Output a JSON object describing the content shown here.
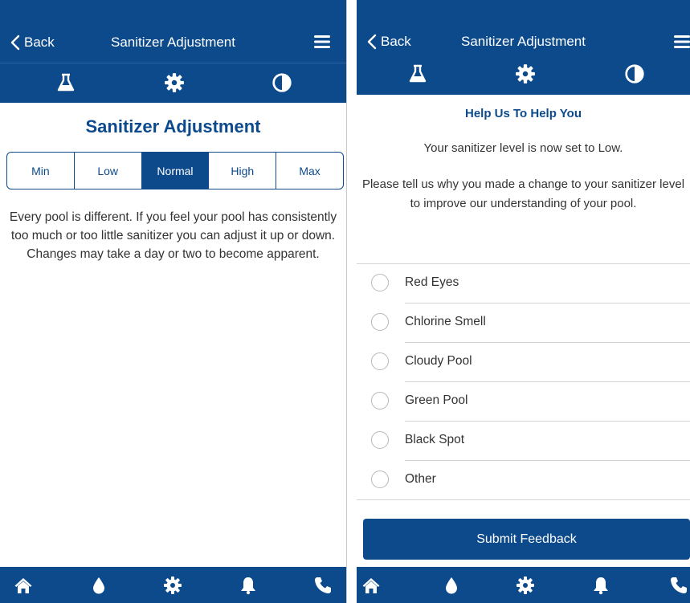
{
  "colors": {
    "primary": "#0d4a8c",
    "text": "#333333",
    "divider": "#d4d4d4"
  },
  "left": {
    "navbar": {
      "back_label": "Back",
      "title": "Sanitizer Adjustment"
    },
    "page_title": "Sanitizer Adjustment",
    "levels": [
      {
        "label": "Min",
        "selected": false
      },
      {
        "label": "Low",
        "selected": false
      },
      {
        "label": "Normal",
        "selected": true
      },
      {
        "label": "High",
        "selected": false
      },
      {
        "label": "Max",
        "selected": false
      }
    ],
    "description": "Every pool is different. If you feel your pool has consistently too much or too little sanitizer you can adjust it up or down. Changes may take a day or two to become apparent."
  },
  "right": {
    "navbar": {
      "back_label": "Back",
      "title": "Sanitizer Adjustment"
    },
    "help_title": "Help Us To Help You",
    "status_text": "Your sanitizer level is now set to Low.",
    "prompt_text": "Please tell us why you made a change to your sanitizer level to improve our understanding of your pool.",
    "options": [
      "Red Eyes",
      "Chlorine Smell",
      "Cloudy Pool",
      "Green Pool",
      "Black Spot",
      "Other"
    ],
    "submit_label": "Submit Feedback"
  },
  "icons": {
    "subnav": [
      "flask-icon",
      "gear-icon",
      "contrast-icon"
    ],
    "tabbar": [
      "home-icon",
      "water-drop-icon",
      "gear-icon",
      "bell-icon",
      "phone-icon"
    ]
  }
}
